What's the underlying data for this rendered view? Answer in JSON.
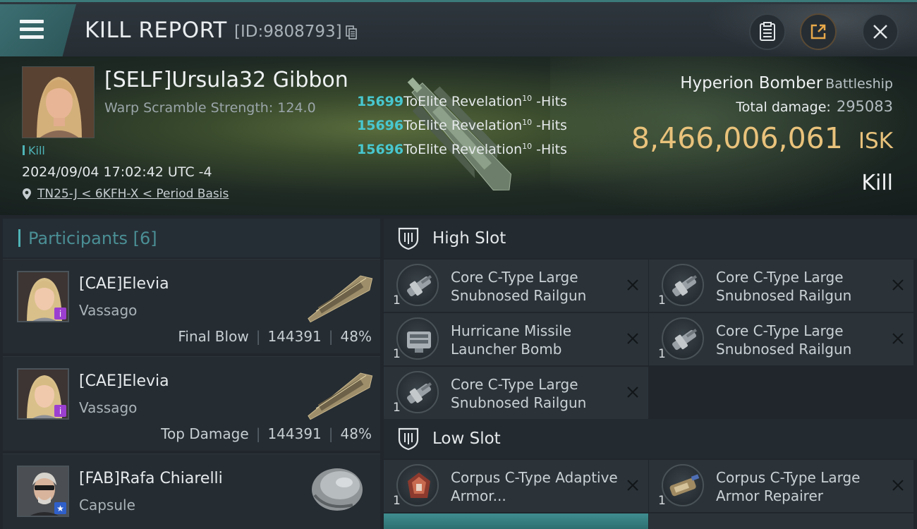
{
  "header": {
    "title": "KILL REPORT",
    "report_id": "[ID:9808793]"
  },
  "victim": {
    "name": "[SELF]Ursula32 Gibbon",
    "scramble": "Warp Scramble Strength: 124.0",
    "tag": "Kill",
    "timestamp": "2024/09/04 17:02:42 UTC -4",
    "location": "TN25-J < 6KFH-X < Period Basis",
    "ship_name": "Hyperion Bomber",
    "ship_class": "Battleship",
    "total_damage_label": "Total damage:",
    "total_damage": "295083",
    "isk_value": "8,466,006,061",
    "isk_unit": "ISK",
    "result": "Kill"
  },
  "hits": [
    {
      "damage": "15699",
      "text": "ToElite Revelation",
      "level": "10",
      "suffix": " -Hits"
    },
    {
      "damage": "15696",
      "text": "ToElite Revelation",
      "level": "10",
      "suffix": " -Hits"
    },
    {
      "damage": "15696",
      "text": "ToElite Revelation",
      "level": "10",
      "suffix": " -Hits"
    }
  ],
  "participants": {
    "label": "Participants",
    "count": "[6]",
    "items": [
      {
        "name": "[CAE]Elevia",
        "ship": "Vassago",
        "role": "Final Blow",
        "damage": "144391",
        "percent": "48%",
        "badge": "i",
        "badge_color": "#9b3fd0"
      },
      {
        "name": "[CAE]Elevia",
        "ship": "Vassago",
        "role": "Top Damage",
        "damage": "144391",
        "percent": "48%",
        "badge": "i",
        "badge_color": "#9b3fd0"
      },
      {
        "name": "[FAB]Rafa Chiarelli",
        "ship": "Capsule",
        "badge": "★",
        "badge_color": "#2f5fc9"
      }
    ]
  },
  "high_slot": {
    "label": "High Slot",
    "items": [
      {
        "name": "Core C-Type Large Snubnosed Railgun",
        "qty": "1"
      },
      {
        "name": "Core C-Type Large Snubnosed Railgun",
        "qty": "1"
      },
      {
        "name": "Hurricane Missile Launcher Bomb",
        "qty": "1"
      },
      {
        "name": "Core C-Type Large Snubnosed Railgun",
        "qty": "1"
      },
      {
        "name": "Core C-Type Large Snubnosed Railgun",
        "qty": "1"
      }
    ]
  },
  "low_slot": {
    "label": "Low Slot",
    "items": [
      {
        "name": "Corpus C-Type Adaptive Armor...",
        "qty": "1"
      },
      {
        "name": "Corpus C-Type Large Armor Repairer",
        "qty": "1"
      }
    ]
  },
  "colors": {
    "accent": "#4fb4b7",
    "isk": "#e9c27b",
    "hit_number": "#48c7cf"
  }
}
